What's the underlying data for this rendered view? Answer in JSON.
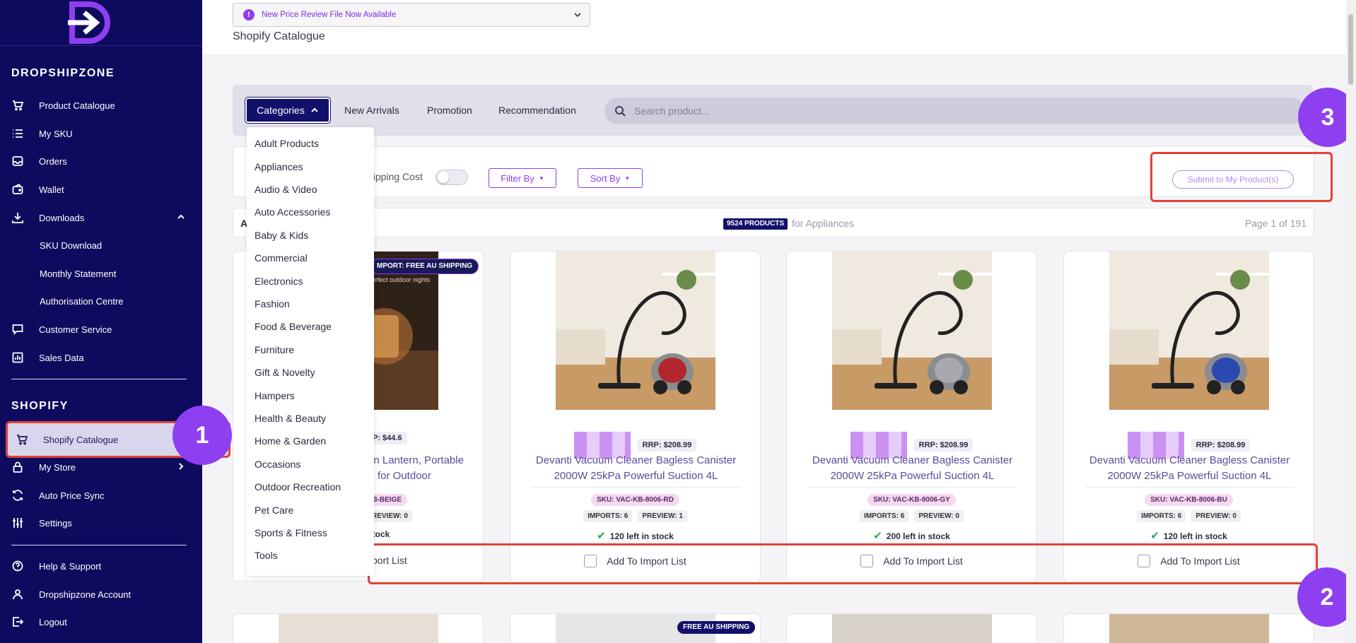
{
  "notice": {
    "text": "New Price Review File Now Available"
  },
  "page_title": "Shopify Catalogue",
  "sidebar": {
    "section_dropshipzone": "DROPSHIPZONE",
    "section_shopify": "SHOPIFY",
    "items": [
      {
        "label": "Product Catalogue"
      },
      {
        "label": "My SKU"
      },
      {
        "label": "Orders"
      },
      {
        "label": "Wallet"
      },
      {
        "label": "Downloads"
      },
      {
        "label": "SKU Download"
      },
      {
        "label": "Monthly Statement"
      },
      {
        "label": "Authorisation Centre"
      },
      {
        "label": "Customer Service"
      },
      {
        "label": "Sales Data"
      },
      {
        "label": "Shopify Catalogue"
      },
      {
        "label": "My Store"
      },
      {
        "label": "Auto Price Sync"
      },
      {
        "label": "Settings"
      },
      {
        "label": "Help & Support"
      },
      {
        "label": "Dropshipzone Account"
      },
      {
        "label": "Logout"
      }
    ]
  },
  "catbar": {
    "categories": "Categories",
    "tabs": [
      "New Arrivals",
      "Promotion",
      "Recommendation"
    ],
    "search_placeholder": "Search product..."
  },
  "categories_list": [
    "Adult Products",
    "Appliances",
    "Audio & Video",
    "Auto Accessories",
    "Baby & Kids",
    "Commercial",
    "Electronics",
    "Fashion",
    "Food & Beverage",
    "Furniture",
    "Gift & Novelty",
    "Hampers",
    "Health & Beauty",
    "Home & Garden",
    "Occasions",
    "Outdoor Recreation",
    "Pet Care",
    "Sports & Fitness",
    "Tools"
  ],
  "filters": {
    "shipping_label": "hipping Cost",
    "filter_by": "Filter By",
    "sort_by": "Sort By",
    "submit": "Submit to My Product(s)"
  },
  "results": {
    "lead": "A",
    "count": "9524 PRODUCTS",
    "for_text": "for Appliances",
    "page": "Page 1 of 191"
  },
  "products": [
    {
      "badge": "MPORT: FREE AU SHIPPING",
      "img_caption": "erfect outdoor nights",
      "rrp": "P: $44.6",
      "name_line1": "an Lantern, Portable",
      "name_line2": "for Outdoor",
      "sku": "3-BEIGE",
      "stats": "REVIEW: 0",
      "stock": "stock",
      "add": "port List"
    },
    {
      "rrp": "RRP: $208.99",
      "name_line1": "Devanti Vacuum Cleaner Bagless Canister",
      "name_line2": "2000W 25kPa Powerful Suction 4L",
      "sku": "SKU: VAC-KB-8006-RD",
      "imports": "IMPORTS: 6",
      "preview": "PREVIEW: 1",
      "stock": "120 left in stock",
      "add": "Add To Import List",
      "color": "#b2262c"
    },
    {
      "rrp": "RRP: $208.99",
      "name_line1": "Devanti Vacuum Cleaner Bagless Canister",
      "name_line2": "2000W 25kPa Powerful Suction 4L",
      "sku": "SKU: VAC-KB-8006-GY",
      "imports": "IMPORTS: 6",
      "preview": "PREVIEW: 0",
      "stock": "200 left in stock",
      "add": "Add To Import List",
      "color": "#8a8a90"
    },
    {
      "rrp": "RRP: $208.99",
      "name_line1": "Devanti Vacuum Cleaner Bagless Canister",
      "name_line2": "2000W 25kPa Powerful Suction 4L",
      "sku": "SKU: VAC-KB-8006-BU",
      "imports": "IMPORTS: 6",
      "preview": "PREVIEW: 0",
      "stock": "120 left in stock",
      "add": "Add To Import List",
      "color": "#2a4ab0"
    }
  ],
  "bottom_badges": [
    "FREE AU SHIPPING"
  ],
  "steps": [
    "1",
    "2",
    "3"
  ],
  "colors": {
    "sidebar": "#0e0b5e",
    "accent": "#8e3ff0",
    "highlight": "#e0413a"
  }
}
